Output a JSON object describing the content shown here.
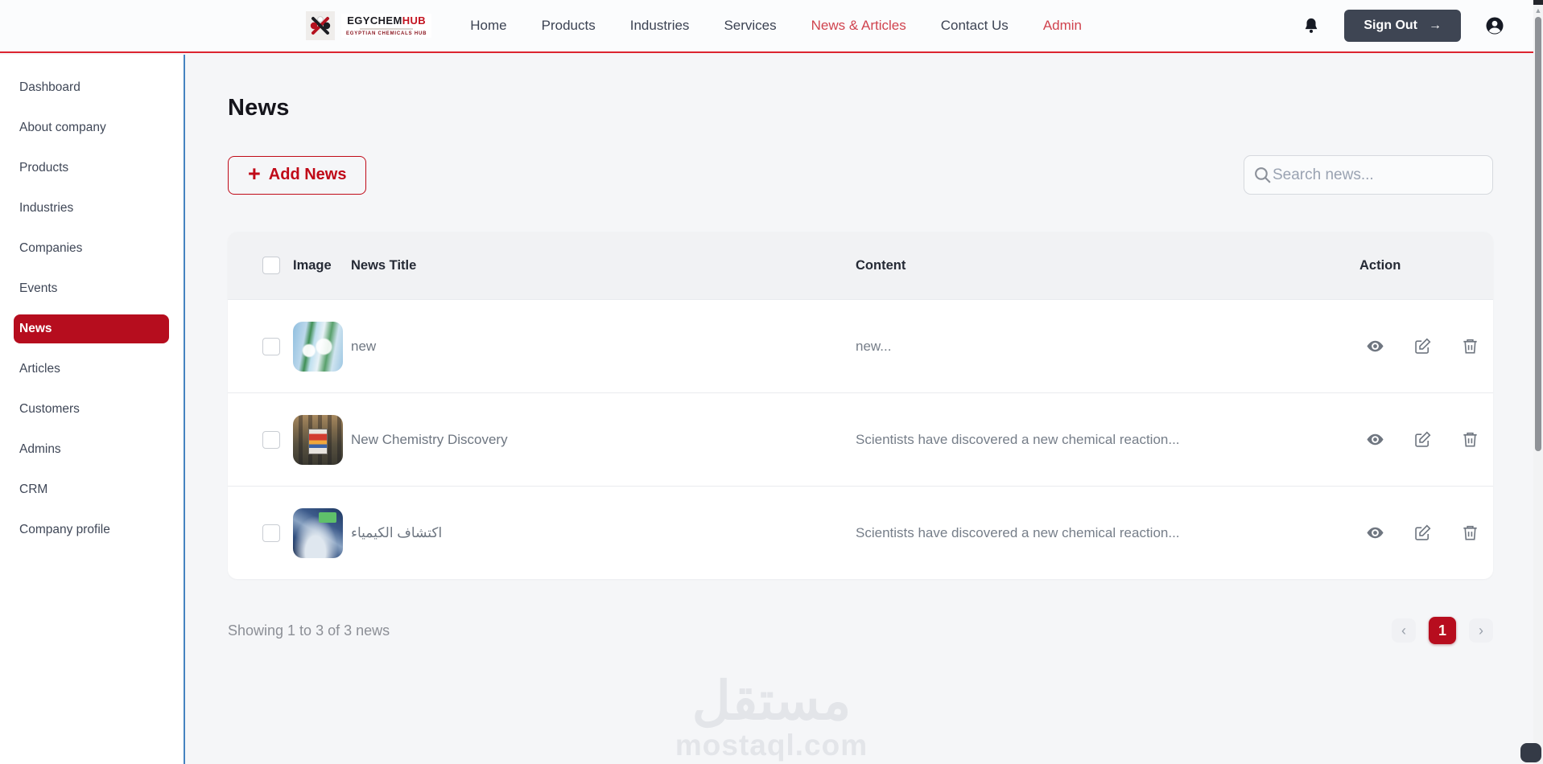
{
  "header": {
    "logo": {
      "brand_black": "EGYCHEM",
      "brand_red": "HUB",
      "tagline": "EGYPTIAN CHEMICALS HUB"
    },
    "nav_items": [
      {
        "label": "Home"
      },
      {
        "label": "Products"
      },
      {
        "label": "Industries"
      },
      {
        "label": "Services"
      },
      {
        "label": "News & Articles",
        "accent": true
      },
      {
        "label": "Contact Us"
      },
      {
        "label": "Admin",
        "accent": true
      }
    ],
    "sign_out": {
      "label": "Sign Out",
      "arrow": "→"
    }
  },
  "sidebar": {
    "items": [
      {
        "label": "Dashboard",
        "active": false
      },
      {
        "label": "About company",
        "active": false
      },
      {
        "label": "Products",
        "active": false
      },
      {
        "label": "Industries",
        "active": false
      },
      {
        "label": "Companies",
        "active": false
      },
      {
        "label": "Events",
        "active": false
      },
      {
        "label": "News",
        "active": true
      },
      {
        "label": "Articles",
        "active": false
      },
      {
        "label": "Customers",
        "active": false
      },
      {
        "label": "Admins",
        "active": false
      },
      {
        "label": "CRM",
        "active": false
      },
      {
        "label": "Company profile",
        "active": false
      }
    ]
  },
  "main": {
    "page_title": "News",
    "add_news": {
      "plus": "+",
      "label": "Add News"
    },
    "search": {
      "placeholder": "Search news..."
    },
    "table": {
      "columns": {
        "image": "Image",
        "title": "News Title",
        "content": "Content",
        "action": "Action"
      },
      "rows": [
        {
          "title": "new",
          "content": "new..."
        },
        {
          "title": "New Chemistry Discovery",
          "content": "Scientists have discovered a new chemical reaction..."
        },
        {
          "title": "اكتشاف الكيمياء",
          "content": "Scientists have discovered a new chemical reaction..."
        }
      ]
    },
    "pagination": {
      "summary": "Showing 1 to 3 of 3 news",
      "prev": "‹",
      "next": "›",
      "page": "1"
    }
  },
  "watermark": {
    "arabic": "مستقل",
    "domain": "mostaql.com"
  },
  "icons": {
    "bell": "bell-icon",
    "account": "account-circle-icon",
    "search": "search-icon",
    "view": "eye-icon",
    "edit": "edit-icon",
    "delete": "trash-icon",
    "logo_mark": "egychemhub-logo-mark"
  },
  "colors": {
    "accent_red": "#b60d1e",
    "nav_red": "#d0434e",
    "header_rule_red": "#dc2430",
    "sidebar_border_blue": "#4583c0",
    "page_bg": "#f5f6f8",
    "signout_bg": "#3e4553"
  }
}
